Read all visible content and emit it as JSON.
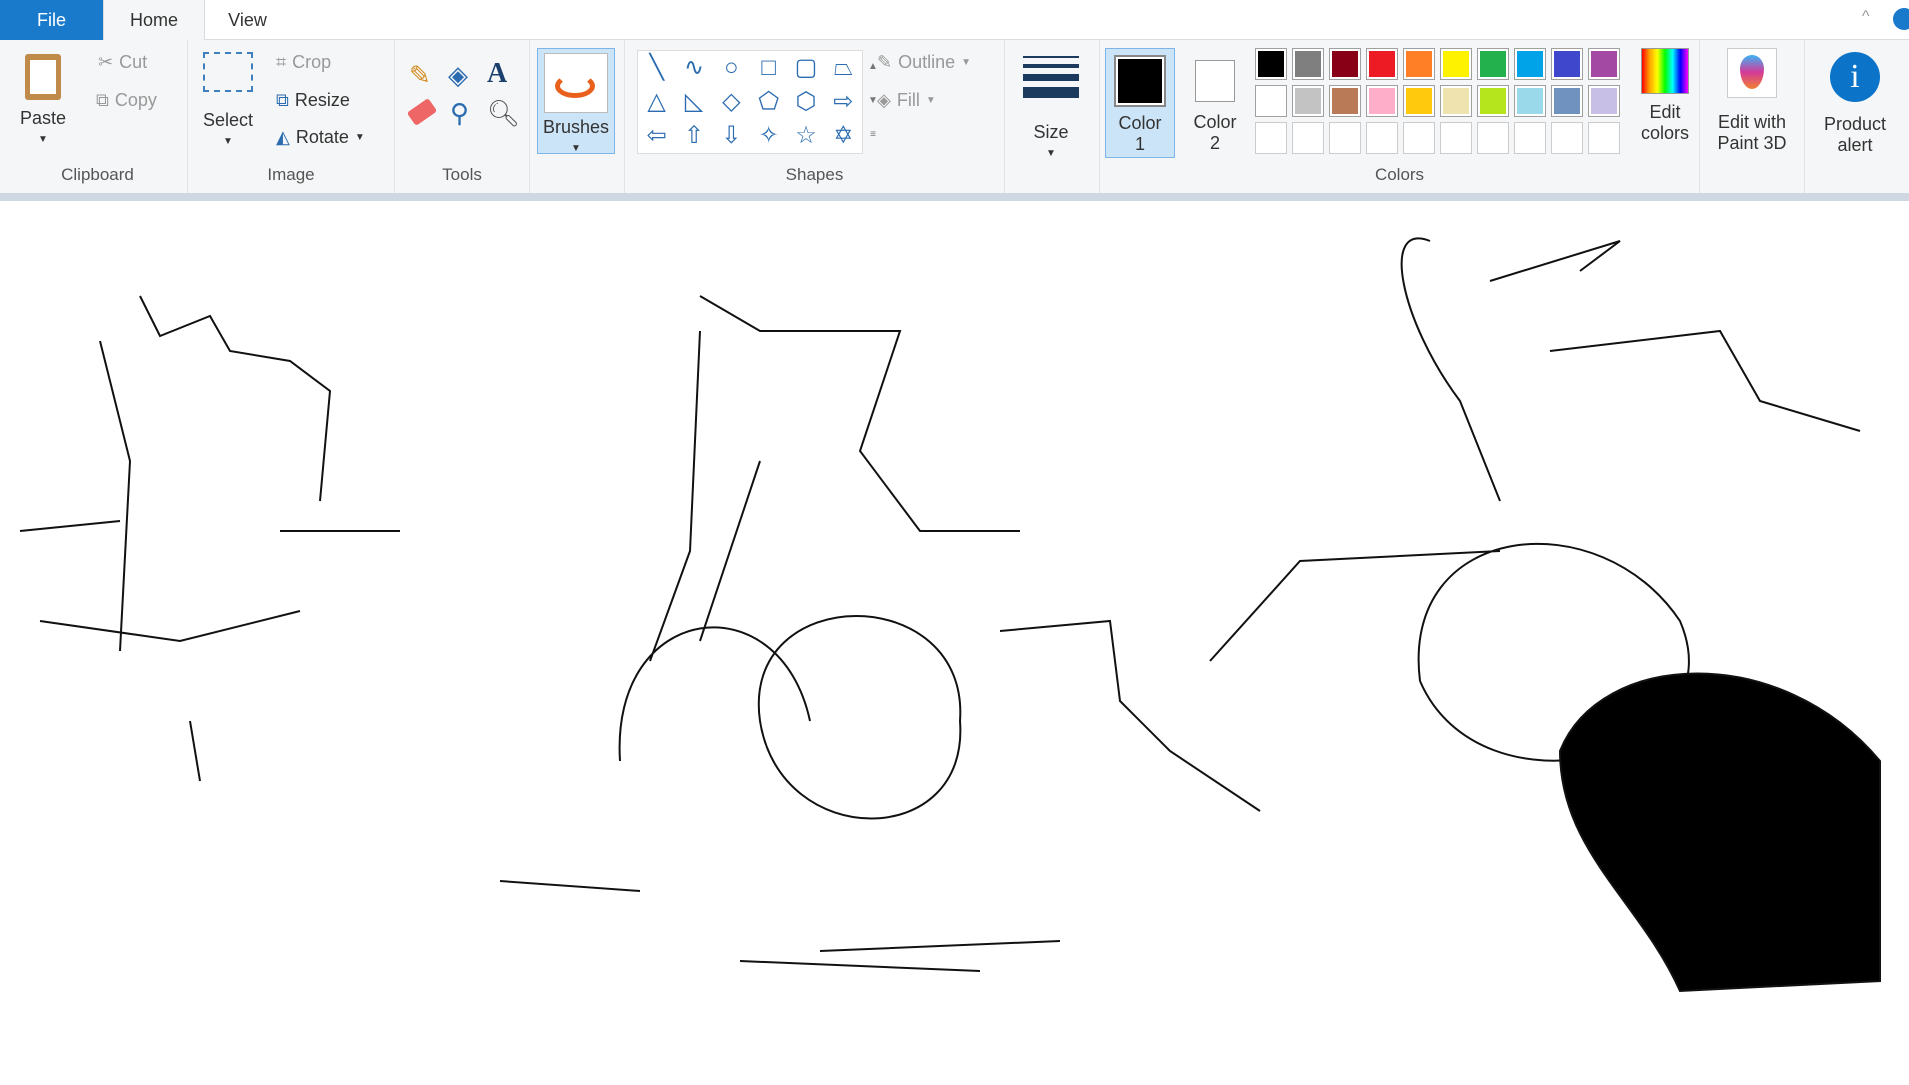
{
  "tabs": [
    {
      "label": "File"
    },
    {
      "label": "Home"
    },
    {
      "label": "View"
    }
  ],
  "clipboard": {
    "paste": "Paste",
    "cut": "Cut",
    "copy": "Copy",
    "group": "Clipboard"
  },
  "image": {
    "select": "Select",
    "crop": "Crop",
    "resize": "Resize",
    "rotate": "Rotate",
    "group": "Image"
  },
  "tools": {
    "group": "Tools"
  },
  "brushes": {
    "label": "Brushes"
  },
  "shapes": {
    "outline": "Outline",
    "fill": "Fill",
    "group": "Shapes"
  },
  "size": {
    "label": "Size"
  },
  "colors": {
    "color1": "Color",
    "color1_num": "1",
    "color2": "Color",
    "color2_num": "2",
    "edit1": "Edit",
    "edit2": "colors",
    "group": "Colors",
    "row1": [
      "#000000",
      "#7f7f7f",
      "#880015",
      "#ed1c24",
      "#ff7f27",
      "#fff200",
      "#22b14c",
      "#00a2e8",
      "#3f48cc",
      "#a349a4"
    ],
    "row2": [
      "#ffffff",
      "#c3c3c3",
      "#b97a57",
      "#ffaec9",
      "#ffc90e",
      "#efe4b0",
      "#b5e61d",
      "#99d9ea",
      "#7092be",
      "#c8bfe7"
    ]
  },
  "paint3d": {
    "l1": "Edit with",
    "l2": "Paint 3D"
  },
  "alert": {
    "l1": "Product",
    "l2": "alert"
  },
  "accent": "#1979ca"
}
